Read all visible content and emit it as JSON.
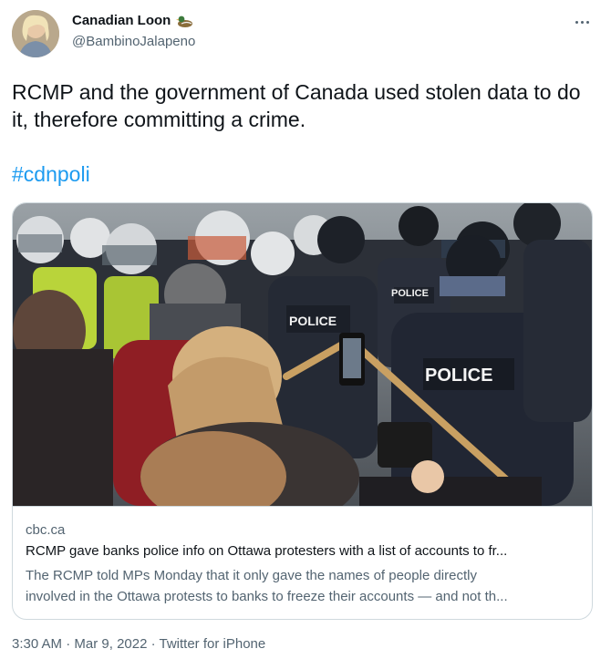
{
  "author": {
    "display_name": "Canadian Loon",
    "handle": "@BambinoJalapeno",
    "name_emoji": "duck-emoji-icon"
  },
  "tweet": {
    "text": "RCMP and the government of Canada used stolen data to do it, therefore committing a crime.",
    "hashtag": "#cdnpoli"
  },
  "card": {
    "image_description_vest_text": "POLICE",
    "domain": "cbc.ca",
    "title": "RCMP gave banks police info on Ottawa protesters with a list of accounts to fr...",
    "description_line1": "The RCMP told MPs Monday that it only gave the names of people directly",
    "description_line2": "involved in the Ottawa protests to banks to freeze their accounts — and not th..."
  },
  "meta": {
    "time": "3:30 AM",
    "separator": " · ",
    "date": "Mar 9, 2022",
    "source": "Twitter for iPhone"
  },
  "colors": {
    "link": "#1d9bf0",
    "secondary_text": "#536471",
    "border": "#cfd9de"
  }
}
